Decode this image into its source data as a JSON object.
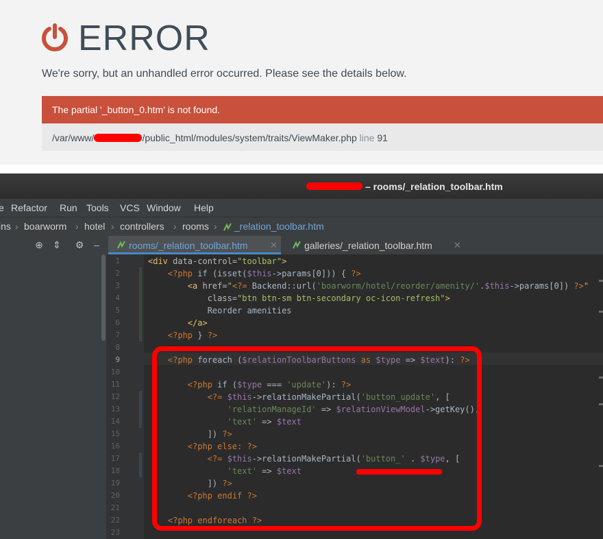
{
  "error_page": {
    "title": "ERROR",
    "message": "We're sorry, but an unhandled error occurred. Please see the details below.",
    "alert_text": "The partial '_button_0.htm' is not found.",
    "path_prefix": "/var/www/",
    "path_suffix": "/public_html/modules/system/traits/ViewMaker.php",
    "line_label": "line",
    "line_number": "91",
    "icon": "power-icon",
    "colors": {
      "accent": "#c9503b",
      "title": "#3f4d5a"
    }
  },
  "ide": {
    "window_title": "– rooms/_relation_toolbar.htm",
    "menu": [
      "e",
      "Refactor",
      "Run",
      "Tools",
      "VCS",
      "Window",
      "Help"
    ],
    "breadcrumbs": [
      "ins",
      "boarworm",
      "hotel",
      "controllers",
      "rooms",
      "_relation_toolbar.htm"
    ],
    "toolbar_icons": [
      "crosshair-icon",
      "collapse-icon",
      "gear-icon",
      "minimize-icon"
    ],
    "tabs": [
      {
        "label": "rooms/_relation_toolbar.htm",
        "active": true
      },
      {
        "label": "galleries/_relation_toolbar.htm",
        "active": false
      }
    ],
    "line_numbers": [
      "1",
      "2",
      "3",
      "4",
      "5",
      "6",
      "7",
      "8",
      "9",
      "10",
      "11",
      "12",
      "13",
      "14",
      "15",
      "16",
      "17",
      "18",
      "19",
      "20",
      "21",
      "22",
      "23"
    ],
    "current_line": "9",
    "code": {
      "l1": [
        "<div ",
        "data-control",
        "=",
        "\"toolbar\"",
        ">"
      ],
      "l2": [
        "<?php ",
        "if (isset(",
        "$this",
        "->params[0])) { ",
        "?>"
      ],
      "l3": [
        "<a ",
        "href",
        "=",
        "\"",
        "<?= ",
        "Backend::url(",
        "'boarworm/hotel/reorder/amenity/'",
        ".",
        "$this",
        "->params[0]) ",
        "?>",
        "\""
      ],
      "l4": [
        "class",
        "=",
        "\"btn btn-sm btn-secondary oc-icon-refresh\"",
        ">"
      ],
      "l5": "Reorder amenities",
      "l6": "</a>",
      "l7": [
        "<?php ",
        "} ",
        "?>"
      ],
      "l9": [
        "<?php ",
        "foreach (",
        "$relationToolbarButtons",
        " as ",
        "$type",
        " => ",
        "$text",
        "): ",
        "?>"
      ],
      "l11": [
        "<?php ",
        "if (",
        "$type",
        " === ",
        "'update'",
        "): ",
        "?>"
      ],
      "l12": [
        "<?= ",
        "$this",
        "->relationMakePartial(",
        "'button_update'",
        ", ["
      ],
      "l13": [
        "'relationManageId'",
        " => ",
        "$relationViewModel",
        "->getKey(),"
      ],
      "l14": [
        "'text'",
        " => ",
        "$text"
      ],
      "l15": [
        "]) ",
        "?>"
      ],
      "l16": [
        "<?php ",
        "else: ",
        "?>"
      ],
      "l17": [
        "<?= ",
        "$this",
        "->relationMakePartial(",
        "'button_'",
        " . ",
        "$type",
        ", ["
      ],
      "l18": [
        "'text'",
        " => ",
        "$text"
      ],
      "l19": [
        "]) ",
        "?>"
      ],
      "l20": [
        "<?php ",
        "endif ",
        "?>"
      ],
      "l22": [
        "<?php ",
        "endforeach ",
        "?>"
      ]
    }
  }
}
